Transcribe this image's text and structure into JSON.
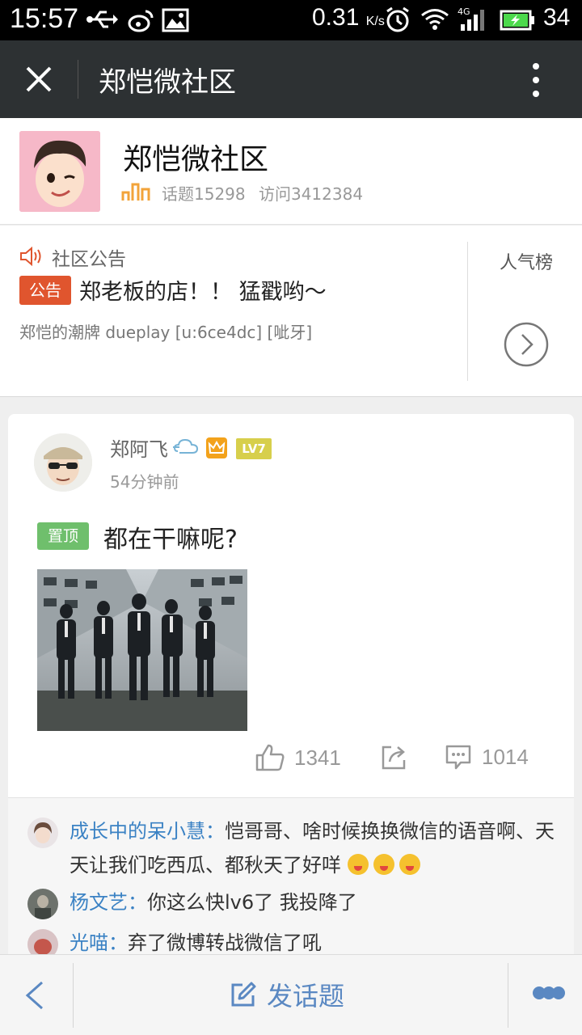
{
  "status_bar": {
    "time": "15:57",
    "net_speed": "0.31",
    "net_unit": "K/s",
    "network": "4G",
    "battery": "34"
  },
  "titlebar": {
    "title": "郑恺微社区"
  },
  "community": {
    "name": "郑恺微社区",
    "topics": "话题15298",
    "visits": "访问3412384"
  },
  "announcement": {
    "section_title": "社区公告",
    "badge": "公告",
    "headline": "郑老板的店！！ 猛戳哟～",
    "sub": "郑恺的潮牌 dueplay [u:6ce4dc] [呲牙]",
    "rank_label": "人气榜"
  },
  "post": {
    "author": "郑阿飞",
    "level": "LV7",
    "time": "54分钟前",
    "pin_label": "置顶",
    "title": "都在干嘛呢?",
    "likes": "1341",
    "comments_count": "1014",
    "comments": [
      {
        "name": "成长中的呆小慧：",
        "text": "恺哥哥、啥时候换换微信的语音啊、天天让我们吃西瓜、都秋天了好咩"
      },
      {
        "name": "杨文艺：",
        "text": "你这么快lv6了 我投降了"
      },
      {
        "name": "光喵：",
        "text": "弃了微博转战微信了吼"
      }
    ]
  },
  "bottom_bar": {
    "post_label": "发话题"
  },
  "colors": {
    "accent_blue": "#5a88c2",
    "badge_red": "#e0552e",
    "pin_green": "#6fbf6c",
    "level_yellow": "#d7cf4c",
    "titlebar": "#2d3133"
  }
}
